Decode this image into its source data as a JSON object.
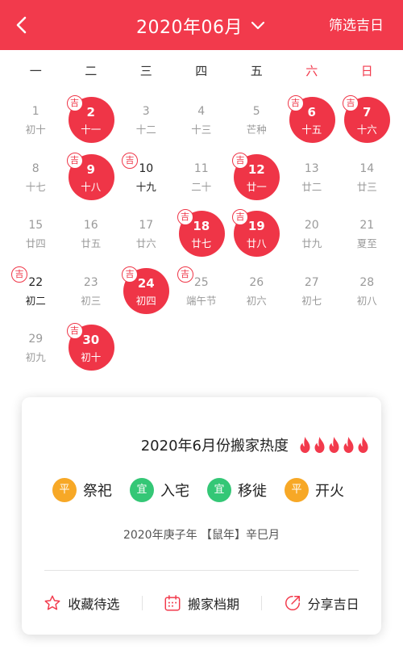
{
  "header": {
    "title": "2020年06月",
    "filter_label": "筛选吉日"
  },
  "weekdays": [
    "一",
    "二",
    "三",
    "四",
    "五",
    "六",
    "日"
  ],
  "lucky_badge": "吉",
  "days": [
    {
      "n": "1",
      "l": "初十",
      "lucky": false,
      "sel": false,
      "dark": false
    },
    {
      "n": "2",
      "l": "十一",
      "lucky": true,
      "sel": true,
      "dark": false
    },
    {
      "n": "3",
      "l": "十二",
      "lucky": false,
      "sel": false,
      "dark": false
    },
    {
      "n": "4",
      "l": "十三",
      "lucky": false,
      "sel": false,
      "dark": false
    },
    {
      "n": "5",
      "l": "芒种",
      "lucky": false,
      "sel": false,
      "dark": false
    },
    {
      "n": "6",
      "l": "十五",
      "lucky": true,
      "sel": true,
      "dark": false
    },
    {
      "n": "7",
      "l": "十六",
      "lucky": true,
      "sel": true,
      "dark": false
    },
    {
      "n": "8",
      "l": "十七",
      "lucky": false,
      "sel": false,
      "dark": false
    },
    {
      "n": "9",
      "l": "十八",
      "lucky": true,
      "sel": true,
      "dark": false
    },
    {
      "n": "10",
      "l": "十九",
      "lucky": true,
      "sel": false,
      "dark": true
    },
    {
      "n": "11",
      "l": "二十",
      "lucky": false,
      "sel": false,
      "dark": false
    },
    {
      "n": "12",
      "l": "廿一",
      "lucky": true,
      "sel": true,
      "dark": false
    },
    {
      "n": "13",
      "l": "廿二",
      "lucky": false,
      "sel": false,
      "dark": false
    },
    {
      "n": "14",
      "l": "廿三",
      "lucky": false,
      "sel": false,
      "dark": false
    },
    {
      "n": "15",
      "l": "廿四",
      "lucky": false,
      "sel": false,
      "dark": false
    },
    {
      "n": "16",
      "l": "廿五",
      "lucky": false,
      "sel": false,
      "dark": false
    },
    {
      "n": "17",
      "l": "廿六",
      "lucky": false,
      "sel": false,
      "dark": false
    },
    {
      "n": "18",
      "l": "廿七",
      "lucky": true,
      "sel": true,
      "dark": false
    },
    {
      "n": "19",
      "l": "廿八",
      "lucky": true,
      "sel": true,
      "dark": false
    },
    {
      "n": "20",
      "l": "廿九",
      "lucky": false,
      "sel": false,
      "dark": false
    },
    {
      "n": "21",
      "l": "夏至",
      "lucky": false,
      "sel": false,
      "dark": false
    },
    {
      "n": "22",
      "l": "初二",
      "lucky": true,
      "sel": false,
      "dark": true
    },
    {
      "n": "23",
      "l": "初三",
      "lucky": false,
      "sel": false,
      "dark": false
    },
    {
      "n": "24",
      "l": "初四",
      "lucky": true,
      "sel": true,
      "dark": false
    },
    {
      "n": "25",
      "l": "端午节",
      "lucky": true,
      "sel": false,
      "dark": false
    },
    {
      "n": "26",
      "l": "初六",
      "lucky": false,
      "sel": false,
      "dark": false
    },
    {
      "n": "27",
      "l": "初七",
      "lucky": false,
      "sel": false,
      "dark": false
    },
    {
      "n": "28",
      "l": "初八",
      "lucky": false,
      "sel": false,
      "dark": false
    },
    {
      "n": "29",
      "l": "初九",
      "lucky": false,
      "sel": false,
      "dark": false
    },
    {
      "n": "30",
      "l": "初十",
      "lucky": true,
      "sel": true,
      "dark": false
    }
  ],
  "card": {
    "heat_title": "2020年6月份搬家热度",
    "heat_flames": 5,
    "activities": [
      {
        "tag": "平",
        "tag_type": "ping",
        "name": "祭祀"
      },
      {
        "tag": "宜",
        "tag_type": "yi",
        "name": "入宅"
      },
      {
        "tag": "宜",
        "tag_type": "yi",
        "name": "移徙"
      },
      {
        "tag": "平",
        "tag_type": "ping",
        "name": "开火"
      }
    ],
    "ganzhi": "2020年庚子年 【鼠年】辛巳月",
    "actions": [
      {
        "icon": "star-icon",
        "label": "收藏待选"
      },
      {
        "icon": "calendar-icon",
        "label": "搬家档期"
      },
      {
        "icon": "share-icon",
        "label": "分享吉日"
      }
    ]
  },
  "colors": {
    "accent": "#f23a4c",
    "ping": "#f7a826",
    "yi": "#34c776"
  }
}
